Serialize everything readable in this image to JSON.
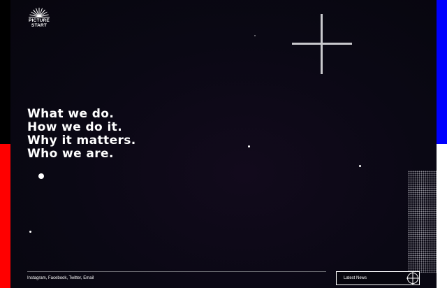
{
  "logo": {
    "line1": "PICTURE",
    "line2": "START",
    "icon": "sunburst-icon"
  },
  "headline": {
    "line1": "What we do.",
    "line2": "How we do it.",
    "line3": "Why it matters.",
    "line4": "Who we are."
  },
  "footer": {
    "social_links": "Instagram, Facebook, Twitter, Email",
    "latest_news_label": "Latest News",
    "latest_news_icon": "crosshair-circle-icon"
  },
  "colors": {
    "left_top_strip": "#000000",
    "left_bottom_strip": "#ff0000",
    "right_top_strip": "#0000ff",
    "right_bottom_strip": "#ffffff",
    "hero_background": "#0a0814",
    "text": "#ffffff"
  }
}
